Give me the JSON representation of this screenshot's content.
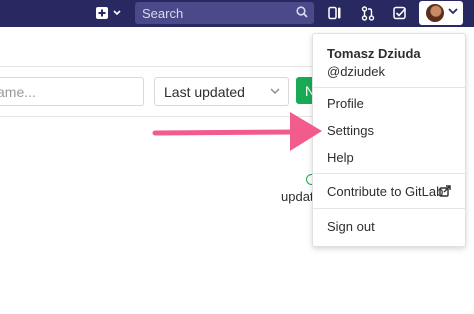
{
  "header": {
    "search_placeholder": "Search"
  },
  "toolbar": {
    "filter_placeholder": "ame...",
    "sort_label": "Last updated",
    "new_label": "N"
  },
  "list": {
    "partial_text": "updat"
  },
  "user_menu": {
    "name": "Tomasz Dziuda",
    "username": "@dziudek",
    "items": {
      "profile": "Profile",
      "settings": "Settings",
      "help": "Help",
      "contribute": "Contribute to GitLab",
      "sign_out": "Sign out"
    }
  },
  "colors": {
    "topbar": "#292961",
    "search_bg": "#4a4a8a",
    "accent_green": "#1aaa55",
    "arrow": "#f25c8d"
  },
  "icons": {
    "new": "plus-square-icon",
    "search": "magnifier-icon",
    "panels": "panels-icon",
    "merge_requests": "merge-request-icon",
    "todos": "check-square-icon",
    "external": "external-link-icon"
  }
}
